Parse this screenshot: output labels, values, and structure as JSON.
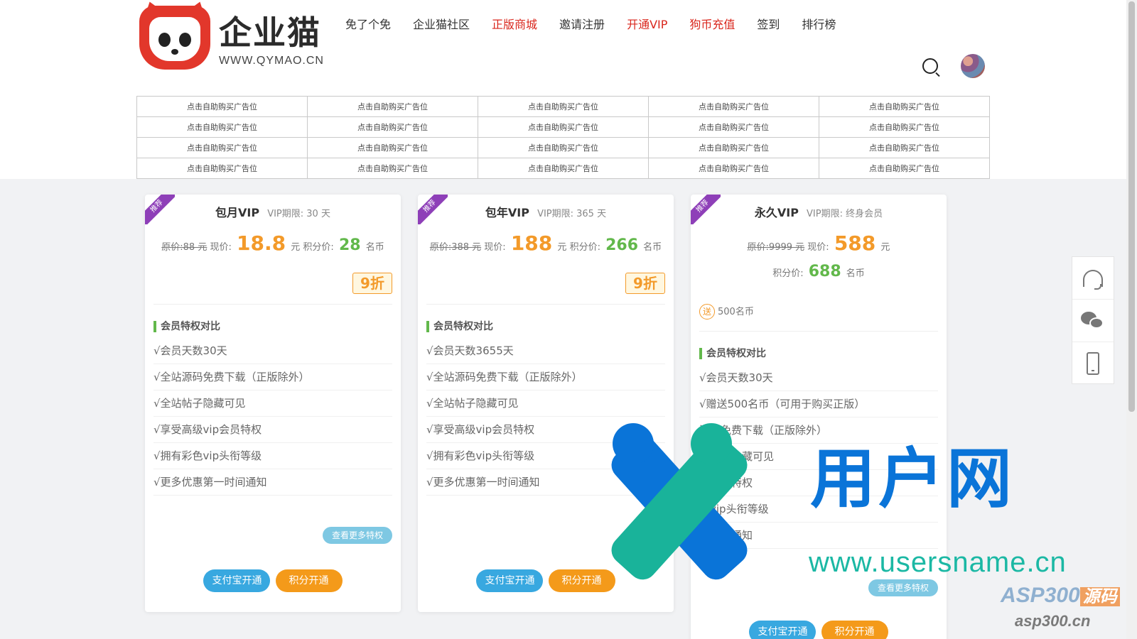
{
  "brand": {
    "name": "企业猫",
    "url": "WWW.QYMAO.CN"
  },
  "nav": [
    {
      "label": "免了个免",
      "color": "normal"
    },
    {
      "label": "企业猫社区",
      "color": "normal"
    },
    {
      "label": "正版商城",
      "color": "red"
    },
    {
      "label": "邀请注册",
      "color": "normal"
    },
    {
      "label": "开通VIP",
      "color": "red"
    },
    {
      "label": "狗币充值",
      "color": "red"
    },
    {
      "label": "签到",
      "color": "normal"
    },
    {
      "label": "排行榜",
      "color": "normal"
    }
  ],
  "ads": {
    "cell_text": "点击自助购买广告位",
    "rows": 4,
    "cols": 5
  },
  "plans": [
    {
      "ribbon": "推荐",
      "name": "包月VIP",
      "period": "VIP期限: 30 天",
      "orig_label": "原价:88 元",
      "now_label": "现价:",
      "now_price": "18.8",
      "unit": "元",
      "points_label": "积分价:",
      "points_price": "28",
      "points_unit": "名币",
      "discount": "9折",
      "features_title": "会员特权对比",
      "features": [
        "√会员天数30天",
        "√全站源码免费下载（正版除外）",
        "√全站帖子隐藏可见",
        "√享受高级vip会员特权",
        "√拥有彩色vip头衔等级",
        "√更多优惠第一时间通知"
      ],
      "more_label": "查看更多特权",
      "alipay_label": "支付宝开通",
      "points_btn_label": "积分开通"
    },
    {
      "ribbon": "推荐",
      "name": "包年VIP",
      "period": "VIP期限: 365 天",
      "orig_label": "原价:388 元",
      "now_label": "现价:",
      "now_price": "188",
      "unit": "元",
      "points_label": "积分价:",
      "points_price": "266",
      "points_unit": "名币",
      "discount": "9折",
      "features_title": "会员特权对比",
      "features": [
        "√会员天数3655天",
        "√全站源码免费下载（正版除外）",
        "√全站帖子隐藏可见",
        "√享受高级vip会员特权",
        "√拥有彩色vip头衔等级",
        "√更多优惠第一时间通知"
      ],
      "alipay_label": "支付宝开通",
      "points_btn_label": "积分开通"
    },
    {
      "ribbon": "推荐",
      "name": "永久VIP",
      "period": "VIP期限: 终身会员",
      "orig_label": "原价:9999 元",
      "now_label": "现价:",
      "now_price": "588",
      "unit": "元",
      "points_label": "积分价:",
      "points_price": "688",
      "points_unit": "名币",
      "gift_icon": "送",
      "gift_text": "500名币",
      "features_title": "会员特权对比",
      "features": [
        "√会员天数30天",
        "√赠送500名币（可用于购买正版）",
        "源码免费下载（正版除外）",
        "站帖子隐藏可见",
        "享会员特权",
        "色vip头衔等级",
        "一时间通知"
      ],
      "more_label": "查看更多特权",
      "alipay_label": "支付宝开通",
      "points_btn_label": "积分开通"
    }
  ],
  "watermark": {
    "big": "用户网",
    "url": "www.usersname.cn",
    "asp": "ASP300",
    "asp_tag": "源码",
    "asp_url": "asp300.cn"
  },
  "colors": {
    "red": "#d9261c",
    "orange": "#f39a2a",
    "green": "#62b84b",
    "purple": "#8e3fb8",
    "blue": "#38a8e0"
  }
}
